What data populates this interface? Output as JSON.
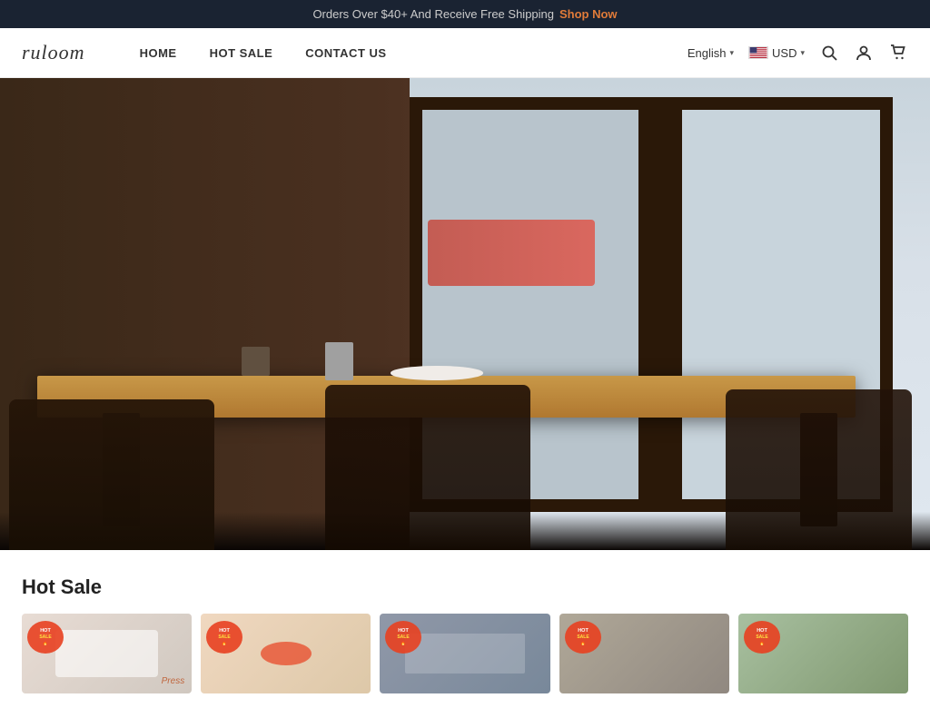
{
  "announcement": {
    "text": "Orders Over $40+ And Receive Free Shipping",
    "cta_label": "Shop Now",
    "cta_url": "#"
  },
  "header": {
    "logo": "ruloom",
    "nav": [
      {
        "label": "HOME",
        "url": "#"
      },
      {
        "label": "HOT SALE",
        "url": "#"
      },
      {
        "label": "CONTACT US",
        "url": "#"
      }
    ],
    "language": {
      "label": "English",
      "chevron": "▾"
    },
    "currency": {
      "label": "USD",
      "chevron": "▾"
    },
    "icons": {
      "search": "🔍",
      "account": "👤",
      "cart": "🛒"
    }
  },
  "hero": {
    "alt": "Restaurant dining table with chairs near window"
  },
  "hot_sale": {
    "title": "Hot Sale",
    "products": [
      {
        "id": 1,
        "alt": "Product 1",
        "color_class": "card-1"
      },
      {
        "id": 2,
        "alt": "Product 2",
        "color_class": "card-2"
      },
      {
        "id": 3,
        "alt": "Product 3",
        "color_class": "card-3"
      },
      {
        "id": 4,
        "alt": "Product 4",
        "color_class": "card-4"
      },
      {
        "id": 5,
        "alt": "Product 5",
        "color_class": "card-5"
      }
    ]
  }
}
